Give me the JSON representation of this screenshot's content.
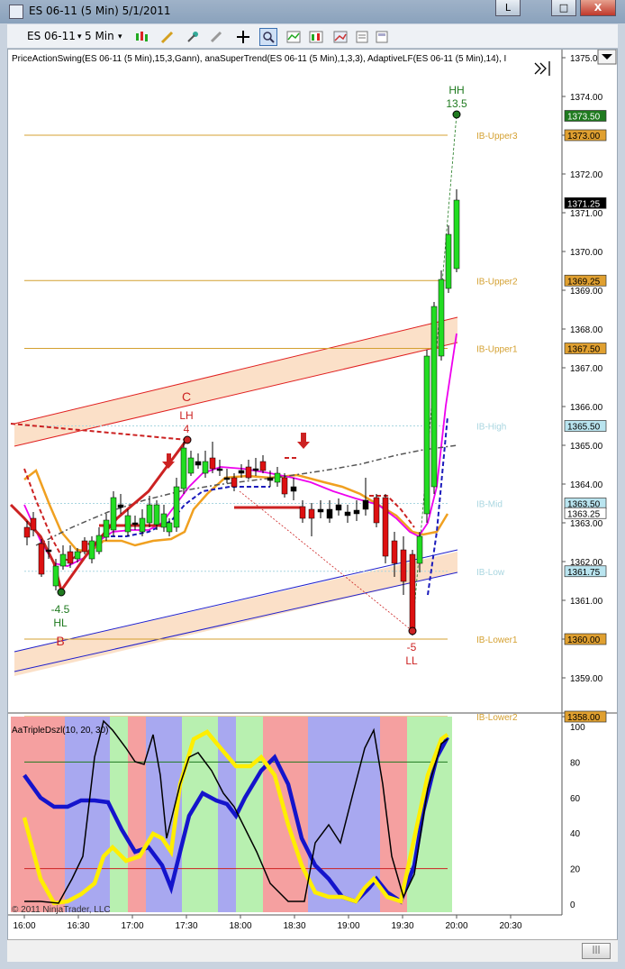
{
  "window": {
    "title": "ES 06-11 (5 Min)  5/1/2011",
    "min_label": "L",
    "restore_label": "□",
    "close_label": "X"
  },
  "toolbar": {
    "instrument": "ES 06-11",
    "interval": "5 Min"
  },
  "price_panel": {
    "indicator_line": "PriceActionSwing(ES 06-11 (5 Min),15,3,Gann), anaSuperTrend(ES 06-11 (5 Min),1,3,3), AdaptiveLF(ES 06-11 (5 Min),14), I",
    "y_ticks": [
      "1375.00",
      "1374.00",
      "1373.00",
      "1372.00",
      "1371.00",
      "1370.00",
      "1369.00",
      "1368.00",
      "1367.00",
      "1366.00",
      "1365.00",
      "1364.00",
      "1363.00",
      "1362.00",
      "1361.00",
      "1360.00",
      "1359.00",
      "1358.00"
    ],
    "price_markers": [
      {
        "label": "1373.50",
        "color": "#1f7a1f"
      },
      {
        "label": "1373.00",
        "color": "#e0a030"
      },
      {
        "label": "1371.25",
        "color": "#000000"
      },
      {
        "label": "1369.25",
        "color": "#e0a030"
      },
      {
        "label": "1367.50",
        "color": "#e0a030"
      },
      {
        "label": "1365.50",
        "color": "#b9e4ef"
      },
      {
        "label": "1363.50",
        "color": "#b9e4ef"
      },
      {
        "label": "1363.25",
        "color": "#ffffff"
      },
      {
        "label": "1361.75",
        "color": "#b9e4ef"
      },
      {
        "label": "1360.00",
        "color": "#e0a030"
      },
      {
        "label": "1358.00",
        "color": "#e0a030"
      }
    ],
    "ib_levels": [
      {
        "label": "IB-Upper3",
        "color": "#d4a030"
      },
      {
        "label": "IB-Upper2",
        "color": "#d4a030"
      },
      {
        "label": "IB-Upper1",
        "color": "#d4a030"
      },
      {
        "label": "IB-High",
        "color": "#a9d6e0"
      },
      {
        "label": "IB-Mid",
        "color": "#a9d6e0"
      },
      {
        "label": "IB-Low",
        "color": "#a9d6e0"
      },
      {
        "label": "IB-Lower1",
        "color": "#d4a030"
      },
      {
        "label": "IB-Lower2",
        "color": "#d4a030"
      }
    ],
    "swing_labels": {
      "hh_tag": "HH",
      "hh_value": "13.5",
      "lh_tag": "LH",
      "lh_value": "4",
      "c_label": "C",
      "hl_value": "-4.5",
      "hl_tag": "HL",
      "b_label": "B",
      "ll_value": "-5",
      "ll_tag": "LL"
    }
  },
  "lower_panel": {
    "indicator_name": "AaTripleDszl(10, 20, 30)",
    "y_ticks": [
      "100",
      "80",
      "60",
      "40",
      "20",
      "0"
    ],
    "copyright": "© 2011 NinjaTrader, LLC"
  },
  "x_axis": {
    "ticks": [
      "16:00",
      "16:30",
      "17:00",
      "17:30",
      "18:00",
      "18:30",
      "19:00",
      "19:30",
      "20:00",
      "20:30"
    ]
  },
  "colors": {
    "up_candle": "#22dd22",
    "down_candle": "#dd1111",
    "doji": "#000000",
    "band_fill": "#fbe0c8",
    "upper_band_line": "#e02020",
    "lower_band_line": "#2020cc",
    "magenta_ma": "#ee00ee",
    "orange_ma": "#f0a020",
    "zone_red": "#f5a0a0",
    "zone_blue": "#a8a8f0",
    "zone_green": "#b8f0b0"
  }
}
